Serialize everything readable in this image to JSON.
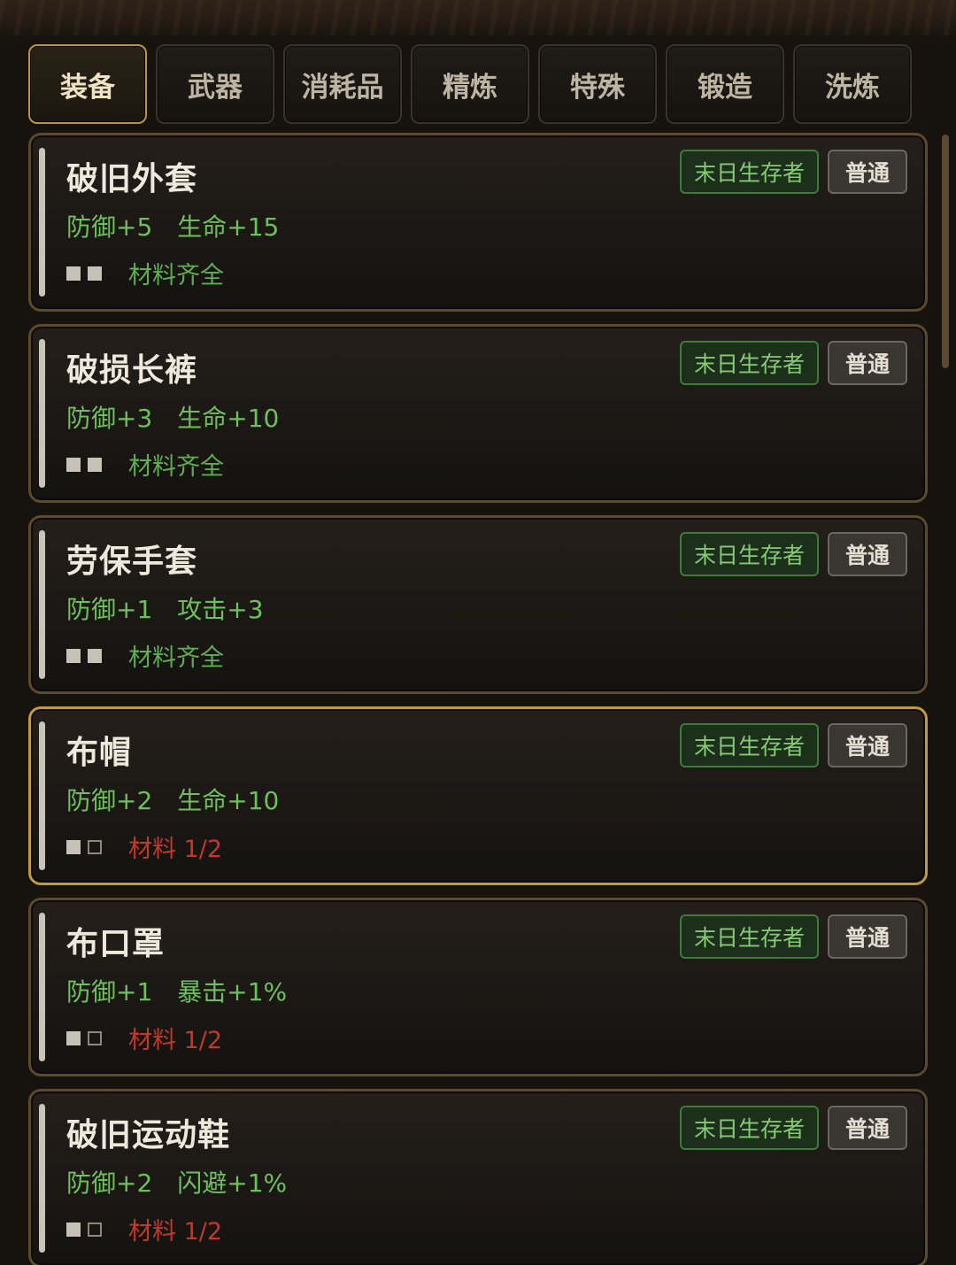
{
  "tabs": [
    {
      "label": "装备",
      "active": true
    },
    {
      "label": "武器",
      "active": false
    },
    {
      "label": "消耗品",
      "active": false
    },
    {
      "label": "精炼",
      "active": false
    },
    {
      "label": "特殊",
      "active": false
    },
    {
      "label": "锻造",
      "active": false
    },
    {
      "label": "洗炼",
      "active": false
    }
  ],
  "colors": {
    "accent_gold": "#bf9a44",
    "stat_green": "#6fbf5f",
    "material_ok": "#5fae52",
    "material_missing": "#c0392b"
  },
  "items": [
    {
      "name": "破旧外套",
      "stats": [
        "防御+5",
        "生命+15"
      ],
      "materials": {
        "have": 2,
        "need": 2
      },
      "material_text": "材料齐全",
      "class_tag": "末日生存者",
      "rarity": "普通",
      "selected": false
    },
    {
      "name": "破损长裤",
      "stats": [
        "防御+3",
        "生命+10"
      ],
      "materials": {
        "have": 2,
        "need": 2
      },
      "material_text": "材料齐全",
      "class_tag": "末日生存者",
      "rarity": "普通",
      "selected": false
    },
    {
      "name": "劳保手套",
      "stats": [
        "防御+1",
        "攻击+3"
      ],
      "materials": {
        "have": 2,
        "need": 2
      },
      "material_text": "材料齐全",
      "class_tag": "末日生存者",
      "rarity": "普通",
      "selected": false
    },
    {
      "name": "布帽",
      "stats": [
        "防御+2",
        "生命+10"
      ],
      "materials": {
        "have": 1,
        "need": 2
      },
      "material_text": "材料 1/2",
      "class_tag": "末日生存者",
      "rarity": "普通",
      "selected": true
    },
    {
      "name": "布口罩",
      "stats": [
        "防御+1",
        "暴击+1%"
      ],
      "materials": {
        "have": 1,
        "need": 2
      },
      "material_text": "材料 1/2",
      "class_tag": "末日生存者",
      "rarity": "普通",
      "selected": false
    },
    {
      "name": "破旧运动鞋",
      "stats": [
        "防御+2",
        "闪避+1%"
      ],
      "materials": {
        "have": 1,
        "need": 2
      },
      "material_text": "材料 1/2",
      "class_tag": "末日生存者",
      "rarity": "普通",
      "selected": false
    }
  ]
}
